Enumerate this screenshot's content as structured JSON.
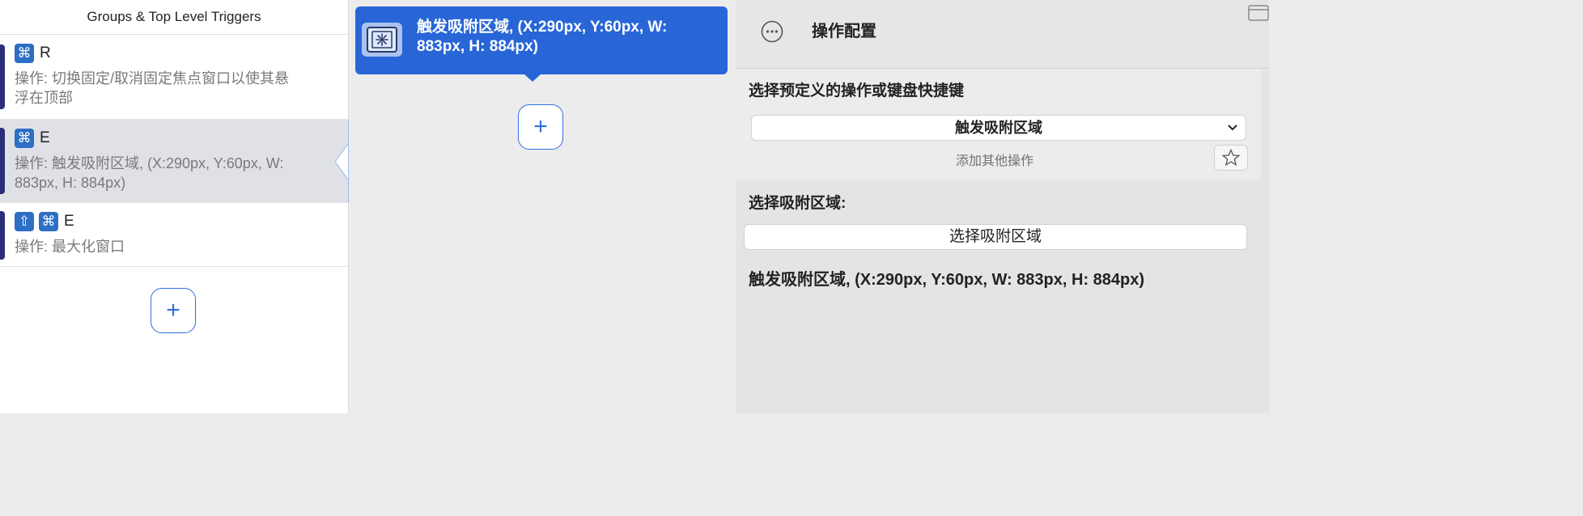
{
  "left_panel": {
    "header": "Groups & Top Level Triggers",
    "triggers": [
      {
        "keys": [
          "command"
        ],
        "key_label": "R",
        "description": "操作: 切换固定/取消固定焦点窗口以使其悬浮在顶部",
        "selected": false
      },
      {
        "keys": [
          "command"
        ],
        "key_label": "E",
        "description": "操作: 触发吸附区域, (X:290px, Y:60px, W: 883px, H: 884px)",
        "selected": true
      },
      {
        "keys": [
          "shift",
          "command"
        ],
        "key_label": "E",
        "description": "操作: 最大化窗口",
        "selected": false
      }
    ],
    "add_button": "+"
  },
  "middle_panel": {
    "action_title": "触发吸附区域, (X:290px, Y:60px, W: 883px, H: 884px)",
    "action_icon": "snap-zone-icon",
    "add_button": "+"
  },
  "right_panel": {
    "title": "操作配置",
    "section1_title": "选择预定义的操作或键盘快捷键",
    "dropdown_value": "触发吸附区域",
    "add_other_label": "添加其他操作",
    "section2_title": "选择吸附区域:",
    "select_zone_button": "选择吸附区域",
    "zone_result": "触发吸附区域, (X:290px, Y:60px, W: 883px, H: 884px)"
  },
  "colors": {
    "accent": "#2866d8",
    "key_badge": "#2d6fc4",
    "trigger_bar": "#2b2f7a",
    "selected_row": "#dfe1e7"
  }
}
